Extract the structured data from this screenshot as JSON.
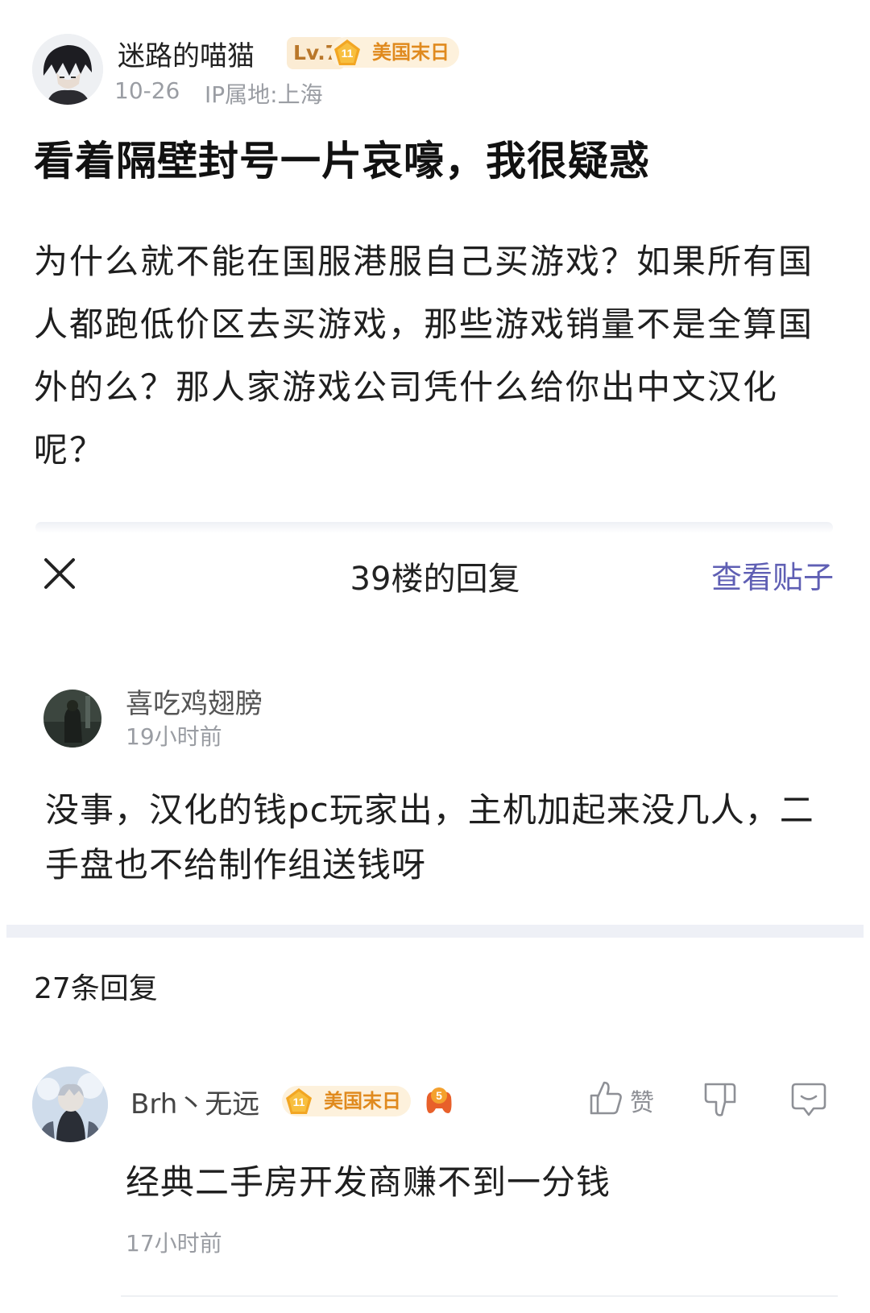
{
  "post": {
    "author": "迷路的喵猫",
    "level": "Lv.7",
    "title_badge_num": "11",
    "title_badge": "美国末日",
    "date": "10-26",
    "ip": "IP属地:上海",
    "title": "看着隔壁封号一片哀嚎，我很疑惑",
    "body": "为什么就不能在国服港服自己买游戏？如果所有国人都跑低价区去买游戏，那些游戏销量不是全算国外的么？那人家游戏公司凭什么给你出中文汉化呢？"
  },
  "panel": {
    "title": "39楼的回复",
    "view_post": "查看贴子"
  },
  "floor": {
    "author": "喜吃鸡翅膀",
    "time": "19小时前",
    "body": "没事，汉化的钱pc玩家出，主机加起来没几人，二手盘也不给制作组送钱呀",
    "reply_count": "27条回复"
  },
  "reply": {
    "author": "Brh丶无远",
    "title_badge_num": "11",
    "title_badge": "美国末日",
    "game_medal_num": "5",
    "like_label": "赞",
    "body": "经典二手房开发商赚不到一分钱",
    "time": "17小时前"
  },
  "icons": {
    "close": "close-icon",
    "like": "thumbs-up-icon",
    "dislike": "thumbs-down-icon",
    "comment": "comment-icon"
  },
  "colors": {
    "accent_link": "#5f5fb4",
    "badge_orange": "#e08a1e",
    "muted": "#9a9da3"
  }
}
